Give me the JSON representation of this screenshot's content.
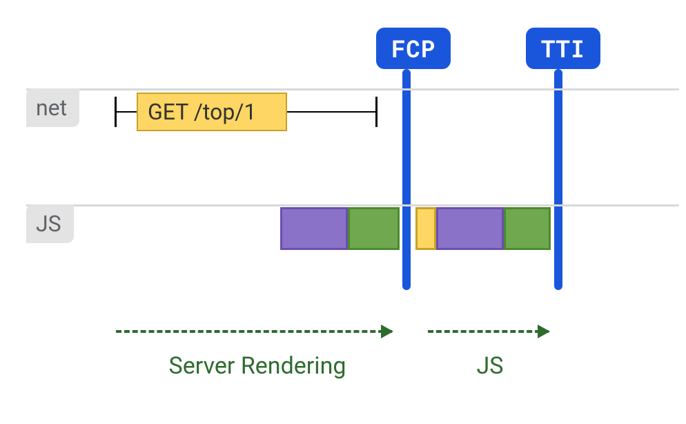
{
  "badges": {
    "fcp": "FCP",
    "tti": "TTI"
  },
  "lanes": {
    "net": "net",
    "js": "JS"
  },
  "network": {
    "request_label": "GET /top/1"
  },
  "phases": {
    "server_rendering": "Server Rendering",
    "js": "JS"
  },
  "colors": {
    "blue": "#1a56db",
    "purple": "#8b72c9",
    "green_task": "#6fa84f",
    "yellow": "#fdd663",
    "arrow": "#2f6b2f"
  },
  "chart_data": {
    "type": "table",
    "description": "Rendering timeline with two lanes (network and JS), two milestone markers (FCP, TTI), and two labeled phases.",
    "x_unit": "relative time (0–100)",
    "markers": [
      {
        "name": "FCP",
        "x": 62
      },
      {
        "name": "TTI",
        "x": 85
      }
    ],
    "lanes": [
      {
        "name": "net",
        "items": [
          {
            "kind": "request",
            "label": "GET /top/1",
            "bar_start": 20,
            "bar_end": 42,
            "span_start": 17,
            "span_end": 55
          }
        ]
      },
      {
        "name": "JS",
        "items": [
          {
            "kind": "task",
            "color": "purple",
            "start": 41,
            "end": 51
          },
          {
            "kind": "task",
            "color": "green",
            "start": 51,
            "end": 59
          },
          {
            "kind": "task",
            "color": "yellow",
            "start": 64,
            "end": 67
          },
          {
            "kind": "task",
            "color": "purple",
            "start": 67,
            "end": 77
          },
          {
            "kind": "task",
            "color": "green",
            "start": 77,
            "end": 83
          }
        ]
      }
    ],
    "phases": [
      {
        "label": "Server Rendering",
        "start": 17,
        "end": 59
      },
      {
        "label": "JS",
        "start": 65,
        "end": 83
      }
    ]
  }
}
